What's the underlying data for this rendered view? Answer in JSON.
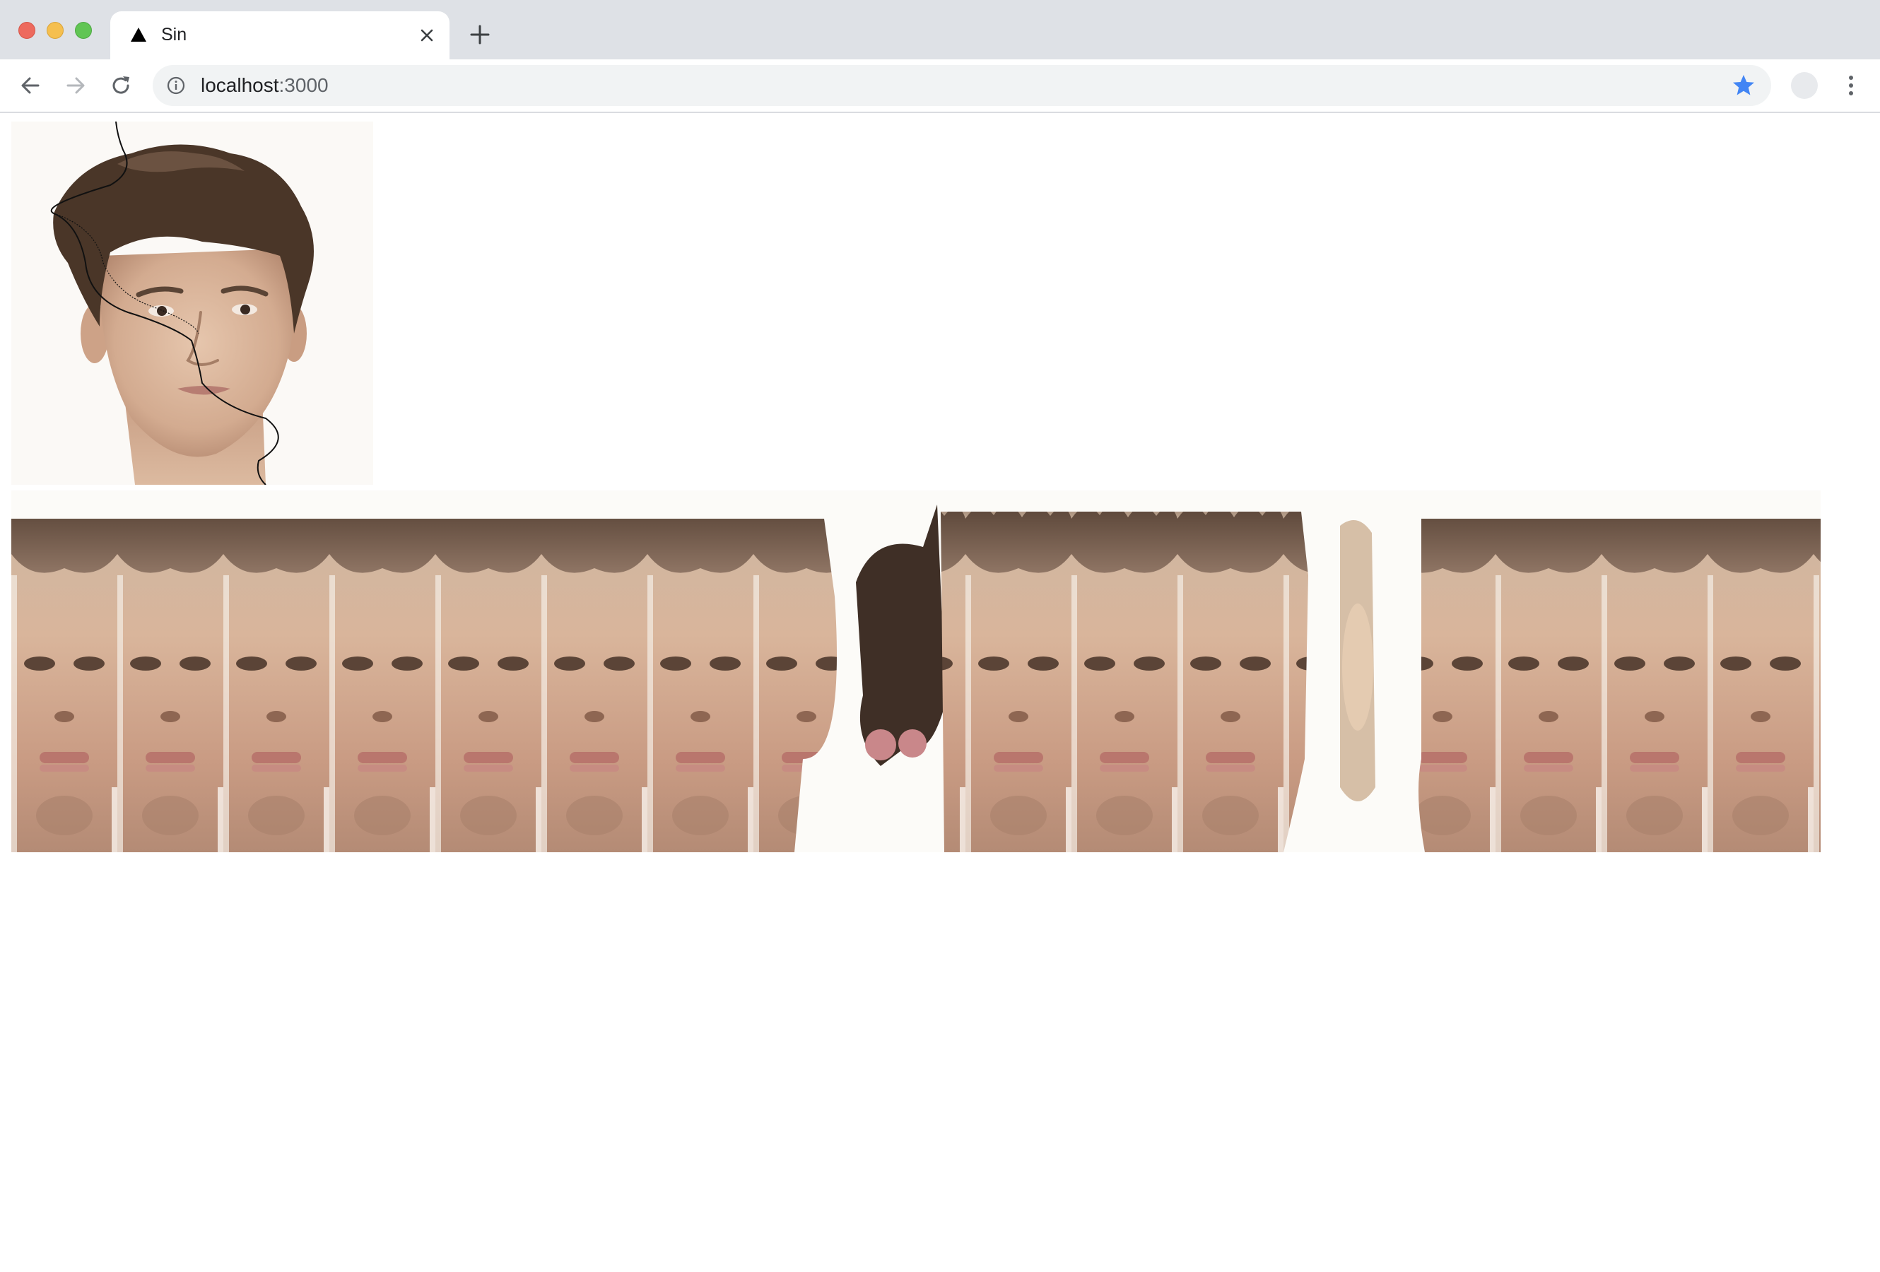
{
  "browser": {
    "tab": {
      "title": "Sin",
      "favicon": "triangle-icon"
    },
    "address_bar": {
      "host": "localhost",
      "port": ":3000"
    },
    "icons": {
      "back": "arrow-left-icon",
      "forward": "arrow-right-icon",
      "reload": "reload-icon",
      "info": "info-icon",
      "bookmark": "star-icon",
      "menu": "kebab-menu-icon",
      "new_tab": "plus-icon",
      "close_tab": "close-icon"
    },
    "colors": {
      "chrome_bg": "#dee1e6",
      "star": "#4285f4",
      "close_dot": "#ed6a5e",
      "minimize_dot": "#f5bf4f",
      "zoom_dot": "#61c554"
    }
  },
  "page": {
    "source_image": "portrait of a man with a sine curve overlay",
    "result_image": "sine-warped repeating face strip"
  }
}
